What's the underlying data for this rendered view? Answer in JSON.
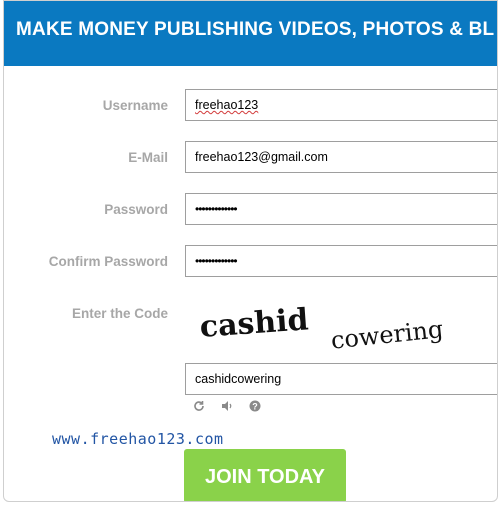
{
  "header": {
    "title": "MAKE MONEY PUBLISHING VIDEOS, PHOTOS & BL"
  },
  "form": {
    "username": {
      "label": "Username",
      "value": "freehao123"
    },
    "email": {
      "label": "E-Mail",
      "value": "freehao123@gmail.com"
    },
    "password": {
      "label": "Password",
      "value": "•••••••••••••"
    },
    "confirm_password": {
      "label": "Confirm Password",
      "value": "•••••••••••••"
    },
    "code": {
      "label": "Enter the Code",
      "value": "cashidcowering"
    }
  },
  "captcha": {
    "words": [
      "cashid",
      "cowering"
    ],
    "tools": [
      "refresh-icon",
      "audio-icon",
      "help-icon"
    ]
  },
  "watermark": "www.freehao123.com",
  "join_button": {
    "label": "JOIN TODAY"
  },
  "colors": {
    "header": "#0a79c1",
    "button": "#8ad24a",
    "label": "#a7a7a7"
  }
}
